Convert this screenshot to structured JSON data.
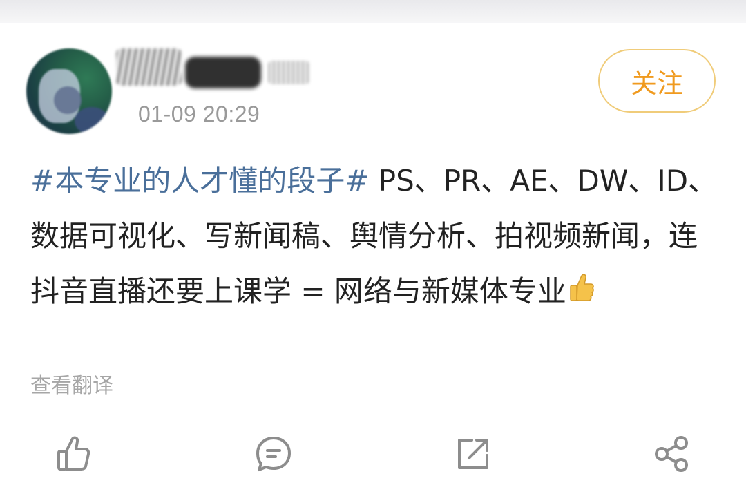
{
  "post": {
    "author": {
      "avatar_icon": "avatar",
      "name_redacted": true
    },
    "timestamp": "01-09 20:29",
    "follow_label": "关注",
    "hashtag": "#本专业的人才懂的段子#",
    "body_text": " PS、PR、AE、DW、ID、数据可视化、写新闻稿、舆情分析、拍视频新闻，连抖音直播还要上课学 = 网络与新媒体专业",
    "emoji": "thumbs-up-emoji",
    "translate_label": "查看翻译"
  },
  "actions": [
    {
      "name": "like",
      "icon": "thumbs-up-outline-icon"
    },
    {
      "name": "comment",
      "icon": "comment-bubble-icon"
    },
    {
      "name": "repost",
      "icon": "repost-icon"
    },
    {
      "name": "share",
      "icon": "share-icon"
    }
  ],
  "colors": {
    "hashtag": "#4a6f9a",
    "follow_text": "#f09a1e",
    "follow_border": "#f0cc7a",
    "icon": "#8d8d8d",
    "meta": "#9a9a9a"
  }
}
